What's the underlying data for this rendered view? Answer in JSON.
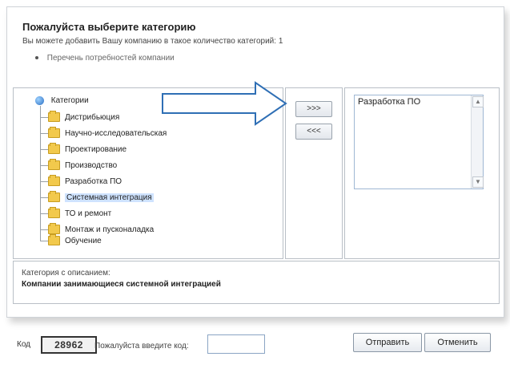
{
  "header": {
    "title": "Пожалуйста выберите категорию",
    "note": "Вы можете добавить Вашу компанию в такое количество категорий: 1",
    "bullet": "Перечень потребностей компании"
  },
  "tree": {
    "root_label": "Категории",
    "items": [
      {
        "label": "Дистрибьюция"
      },
      {
        "label": "Научно-исследовательская"
      },
      {
        "label": "Проектирование"
      },
      {
        "label": "Производство"
      },
      {
        "label": "Разработка ПО"
      },
      {
        "label": "Системная интеграция",
        "selected": true
      },
      {
        "label": "ТО и ремонт"
      },
      {
        "label": "Монтаж и пусконаладка"
      },
      {
        "label": "Обучение"
      }
    ]
  },
  "transfer": {
    "add_label": ">>>",
    "remove_label": "<<<"
  },
  "selected_list": {
    "items": [
      "Разработка ПО"
    ]
  },
  "description": {
    "label": "Категория с описанием:",
    "value": "Компании занимающиеся системной интеграцией"
  },
  "captcha": {
    "label": "Код",
    "code": "28962",
    "hint": "Пожалуйста введите код:",
    "input_value": ""
  },
  "actions": {
    "send_label": "Отправить",
    "cancel_label": "Отменить"
  },
  "colors": {
    "selection": "#cfe3ff",
    "border": "#b9bfc6",
    "arrow_stroke": "#2f6fb5"
  },
  "icons": {
    "root": "globe-icon",
    "folder": "folder-icon",
    "arrow": "arrow-right-icon",
    "scroll_up": "chevron-up-icon",
    "scroll_down": "chevron-down-icon"
  }
}
